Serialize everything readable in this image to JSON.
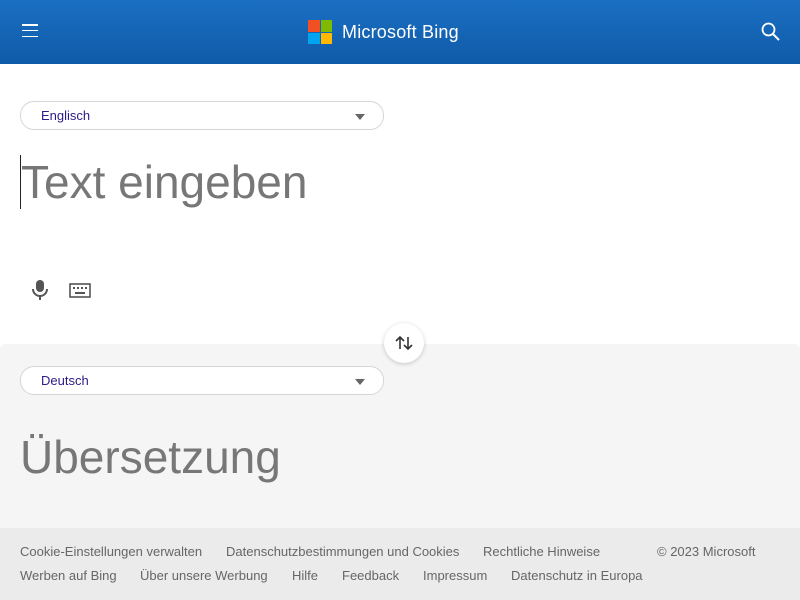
{
  "header": {
    "brand": "Microsoft Bing",
    "menu_icon": "hamburger-icon",
    "search_icon": "search-icon",
    "logo_colors": [
      "#f25022",
      "#7fba00",
      "#00a4ef",
      "#ffb900"
    ],
    "background": "#1565b8"
  },
  "source": {
    "language": "Englisch",
    "placeholder": "Text eingeben",
    "mic_icon": "microphone-icon",
    "keyboard_icon": "keyboard-icon"
  },
  "swap_icon": "swap-arrows-icon",
  "target": {
    "language": "Deutsch",
    "placeholder": "Übersetzung"
  },
  "footer": {
    "row1": [
      "Cookie-Einstellungen verwalten",
      "Datenschutzbestimmungen und Cookies",
      "Rechtliche Hinweise"
    ],
    "copyright": "© 2023 Microsoft",
    "row2": [
      "Werben auf Bing",
      "Über unsere Werbung",
      "Hilfe",
      "Feedback",
      "Impressum",
      "Datenschutz in Europa"
    ]
  }
}
